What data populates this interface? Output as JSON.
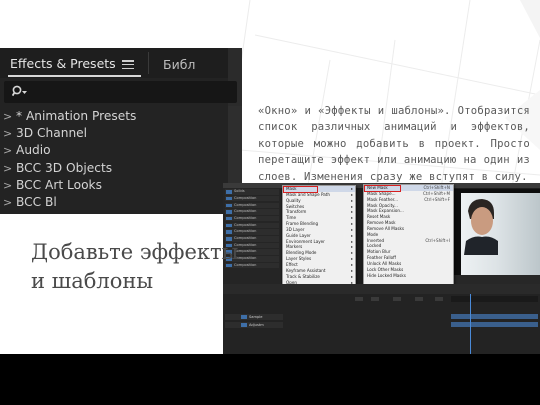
{
  "effects_panel": {
    "tab_active": "Effects & Presets",
    "tab_other": "Библ",
    "items": [
      "* Animation Presets",
      "3D Channel",
      "Audio",
      "BCC 3D Objects",
      "BCC Art Looks",
      "BCC Bl"
    ]
  },
  "paragraph": "«Окно» и «Эффекты и шаблоны». Отобразится список различных анимаций и эффектов, которые можно добавить в проект. Просто перетащите эффект или анимацию на один из слоев. Изменения сразу же вступят в силу.",
  "heading": "Добавьте эффекты\nи шаблоны",
  "ae": {
    "project_items": [
      "Solids",
      "Composition",
      "Composition",
      "Composition",
      "Composition",
      "Composition",
      "Composition",
      "Composition",
      "Composition",
      "Composition",
      "Composition",
      "Composition"
    ],
    "layer_menu": [
      {
        "label": "Mask",
        "hl": true
      },
      {
        "label": "Mask and Shape Path"
      },
      {
        "label": "Quality"
      },
      {
        "label": "Switches"
      },
      {
        "label": "Transform"
      },
      {
        "label": "Time"
      },
      {
        "label": "Frame Blending"
      },
      {
        "label": "3D Layer"
      },
      {
        "label": "Guide Layer"
      },
      {
        "label": "Environment Layer"
      },
      {
        "label": "Markers"
      },
      {
        "label": "Blending Mode"
      },
      {
        "label": "Layer Styles"
      },
      {
        "label": "Effect"
      },
      {
        "label": "Keyframe Assistant"
      },
      {
        "label": "Track & Stabilize"
      },
      {
        "label": "Open"
      },
      {
        "label": "Reveal"
      },
      {
        "label": "Create"
      },
      {
        "label": "Camera"
      },
      {
        "label": "Pre-compose..."
      },
      {
        "label": "Invert Selection"
      },
      {
        "label": "Select Children"
      },
      {
        "label": "Rename"
      }
    ],
    "mask_menu": [
      {
        "label": "New Mask",
        "shortcut": "Ctrl+Shift+N",
        "hl": true
      },
      {
        "label": "Mask Shape...",
        "shortcut": "Ctrl+Shift+M"
      },
      {
        "label": "Mask Feather...",
        "shortcut": "Ctrl+Shift+F"
      },
      {
        "label": "Mask Opacity..."
      },
      {
        "label": "Mask Expansion..."
      },
      {
        "label": "Reset Mask"
      },
      {
        "label": "Remove Mask"
      },
      {
        "label": "Remove All Masks"
      },
      {
        "label": "Mode"
      },
      {
        "label": "Inverted",
        "shortcut": "Ctrl+Shift+I"
      },
      {
        "label": "Locked"
      },
      {
        "label": "Motion Blur"
      },
      {
        "label": "Feather Falloff"
      },
      {
        "label": "Unlock All Masks"
      },
      {
        "label": "Lock Other Masks"
      },
      {
        "label": "Hide Locked Masks"
      }
    ],
    "timeline_layers": [
      "Sample",
      "Adjustm"
    ],
    "colors": {
      "track": "#3a5f8c",
      "highlight": "#d62020"
    }
  }
}
